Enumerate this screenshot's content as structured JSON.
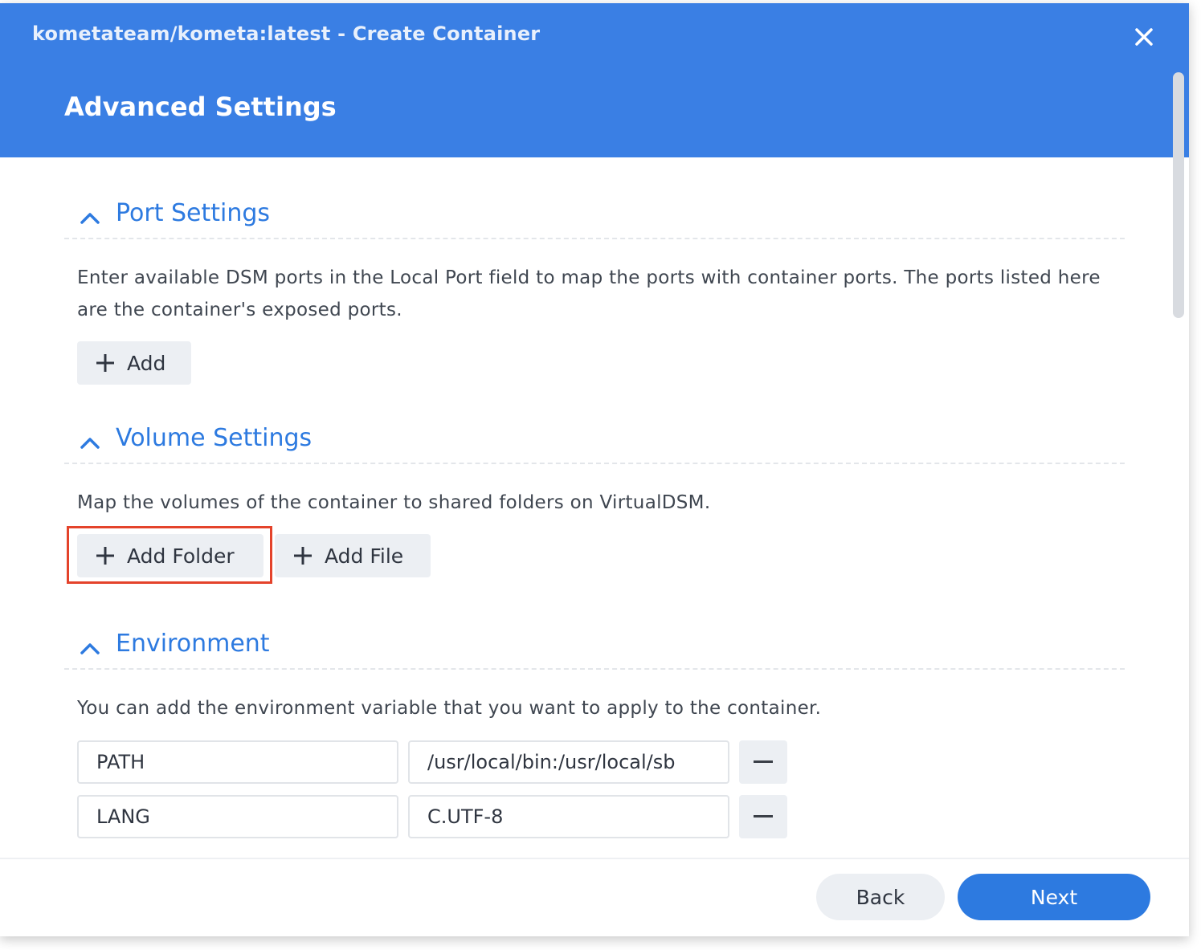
{
  "window": {
    "title": "kometateam/kometa:latest - Create Container",
    "close_icon": "close-icon"
  },
  "header": {
    "title": "Advanced Settings"
  },
  "sections": {
    "ports": {
      "title": "Port Settings",
      "description": "Enter available DSM ports in the Local Port field to map the ports with container ports. The ports listed here are the container's exposed ports.",
      "add_label": "Add"
    },
    "volumes": {
      "title": "Volume Settings",
      "description": "Map the volumes of the container to shared folders on VirtualDSM.",
      "add_folder_label": "Add Folder",
      "add_file_label": "Add File"
    },
    "environment": {
      "title": "Environment",
      "description": "You can add the environment variable that you want to apply to the container.",
      "variables": [
        {
          "name": "PATH",
          "value": "/usr/local/bin:/usr/local/sb"
        },
        {
          "name": "LANG",
          "value": "C.UTF-8"
        }
      ]
    }
  },
  "footer": {
    "back_label": "Back",
    "next_label": "Next"
  },
  "colors": {
    "header_blue": "#3a7fe4",
    "accent_blue": "#2d7ae0",
    "highlight_red": "#e4432b"
  }
}
